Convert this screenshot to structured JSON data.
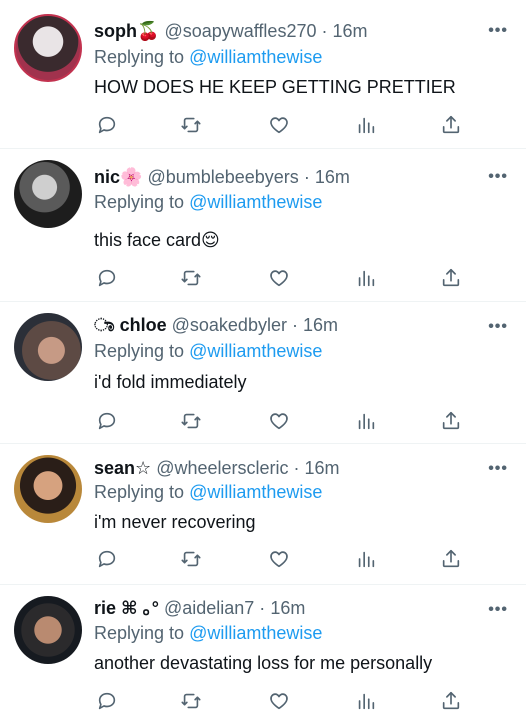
{
  "tweets": [
    {
      "name": "soph🍒",
      "handle": "@soapywaffles270",
      "dot": "·",
      "time": "16m",
      "reply_prefix": "Replying to",
      "reply_to": "@williamthewise",
      "text": "HOW DOES HE KEEP GETTING PRETTIER",
      "more": "•••"
    },
    {
      "name": "nic🌸",
      "handle": "@bumblebeebyers",
      "dot": "·",
      "time": "16m",
      "reply_prefix": "Replying to",
      "reply_to": "@williamthewise",
      "text": "this face card😌",
      "more": "•••"
    },
    {
      "name": "ಾ chloe",
      "handle": "@soakedbyler",
      "dot": "·",
      "time": "16m",
      "reply_prefix": "Replying to",
      "reply_to": "@williamthewise",
      "text": "i'd fold immediately",
      "more": "•••"
    },
    {
      "name": "sean☆",
      "handle": "@wheelerscleric",
      "dot": "·",
      "time": "16m",
      "reply_prefix": "Replying to",
      "reply_to": "@williamthewise",
      "text": "i'm never recovering",
      "more": "•••"
    },
    {
      "name": "rie ⌘ ｡°",
      "handle": "@aidelian7",
      "dot": "·",
      "time": "16m",
      "reply_prefix": "Replying to",
      "reply_to": "@williamthewise",
      "text": "another devastating loss for me personally",
      "more": "•••"
    }
  ],
  "icons": {
    "reply": "reply-icon",
    "retweet": "retweet-icon",
    "like": "like-icon",
    "analytics": "analytics-icon",
    "share": "share-icon"
  },
  "colors": {
    "link": "#1d9bf0",
    "secondary": "#536471",
    "text": "#0f1419",
    "divider": "#eff3f4"
  }
}
